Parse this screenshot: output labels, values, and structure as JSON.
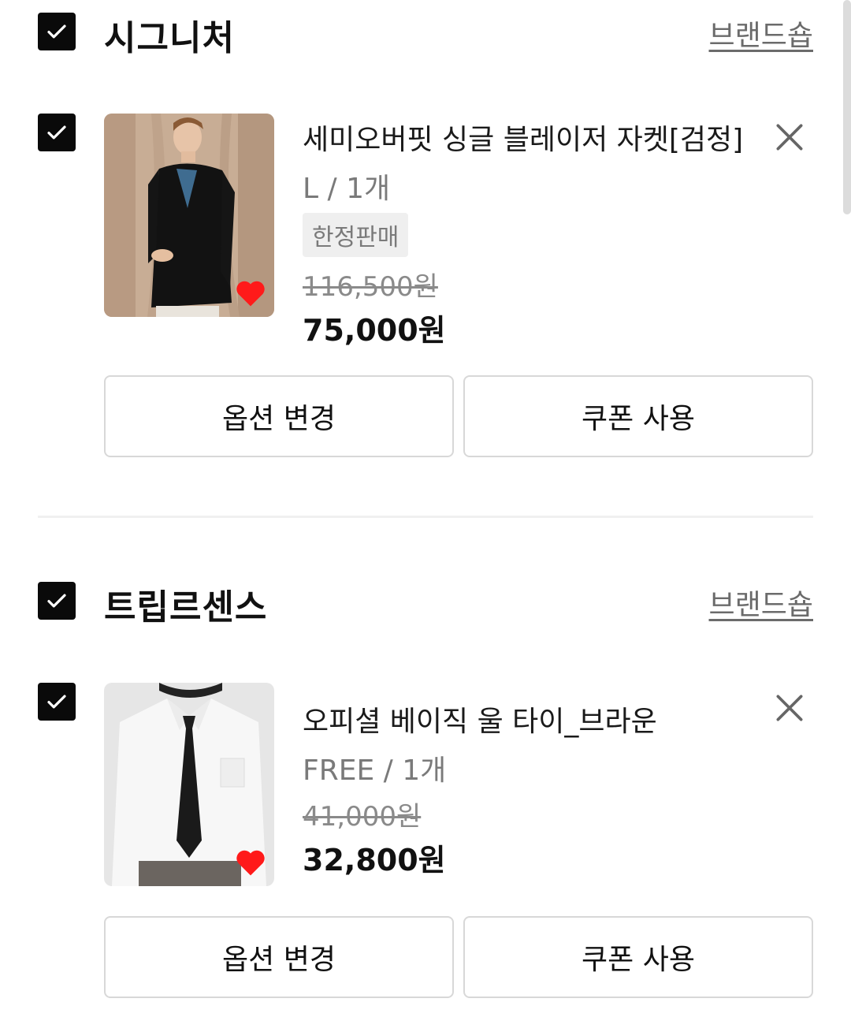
{
  "sections": [
    {
      "brand": "시그니처",
      "brandshop_label": "브랜드숍",
      "item": {
        "name": "세미오버핏 싱글 블레이저 자켓[검정]",
        "option": "L / 1개",
        "tag": "한정판매",
        "original_price": "116,500원",
        "price": "75,000원"
      },
      "option_button": "옵션 변경",
      "coupon_button": "쿠폰 사용"
    },
    {
      "brand": "트립르센스",
      "brandshop_label": "브랜드숍",
      "item": {
        "name": "오피셜 베이직 울 타이_브라운",
        "option": "FREE / 1개",
        "original_price": "41,000원",
        "price": "32,800원"
      },
      "option_button": "옵션 변경",
      "coupon_button": "쿠폰 사용"
    }
  ],
  "colors": {
    "accent": "#0a0a0a",
    "heart": "#ff1a1a",
    "muted": "#7a7a7a"
  },
  "icons": [
    "check-icon",
    "close-icon",
    "heart-icon"
  ]
}
